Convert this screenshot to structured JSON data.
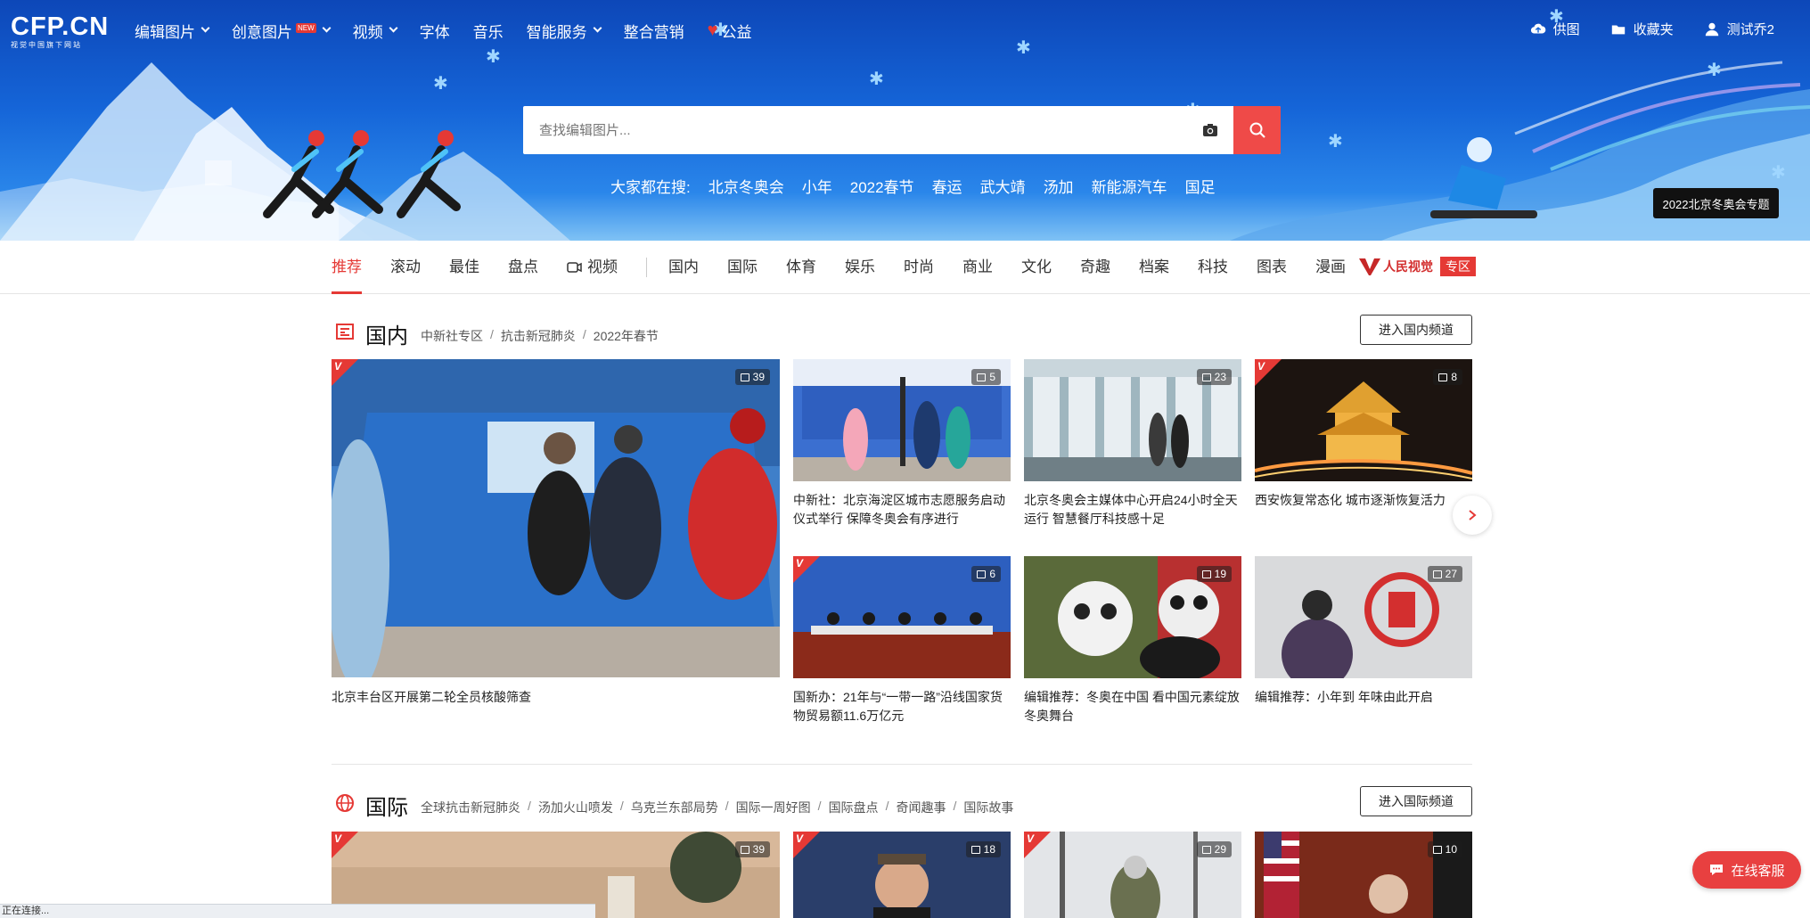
{
  "header": {
    "logo_main": "CFP.CN",
    "logo_sub": "视觉中国旗下网站",
    "nav": [
      {
        "label": "编辑图片",
        "caret": true,
        "new": false
      },
      {
        "label": "创意图片",
        "caret": true,
        "new": true
      },
      {
        "label": "视频",
        "caret": true,
        "new": false
      },
      {
        "label": "字体",
        "caret": false,
        "new": false
      },
      {
        "label": "音乐",
        "caret": false,
        "new": false
      },
      {
        "label": "智能服务",
        "caret": true,
        "new": false
      },
      {
        "label": "整合营销",
        "caret": false,
        "new": false
      },
      {
        "label": "公益",
        "caret": false,
        "new": false,
        "heart": true
      }
    ],
    "new_badge": "NEW",
    "user": {
      "upload": "供图",
      "favorites": "收藏夹",
      "username": "测试乔2"
    }
  },
  "search": {
    "placeholder": "查找编辑图片...",
    "hot_label": "大家都在搜:",
    "hot_terms": [
      "北京冬奥会",
      "小年",
      "2022春节",
      "春运",
      "武大靖",
      "汤加",
      "新能源汽车",
      "国足"
    ],
    "special_button": "2022北京冬奥会专题"
  },
  "channels": {
    "items": [
      "推荐",
      "滚动",
      "最佳",
      "盘点",
      "视频",
      "国内",
      "国际",
      "体育",
      "娱乐",
      "时尚",
      "商业",
      "文化",
      "奇趣",
      "档案",
      "科技",
      "图表",
      "漫画"
    ],
    "active": "推荐",
    "people_visual_name": "人民视觉",
    "people_visual_badge": "专区"
  },
  "section_domestic": {
    "title": "国内",
    "subtopics": [
      "中新社专区",
      "抗击新冠肺炎",
      "2022年春节"
    ],
    "enter_label": "进入国内频道",
    "cards": [
      {
        "count": "39",
        "caption": "北京丰台区开展第二轮全员核酸筛查",
        "vtag": true
      },
      {
        "count": "5",
        "caption": "中新社：北京海淀区城市志愿服务启动仪式举行 保障冬奥会有序进行",
        "vtag": false
      },
      {
        "count": "23",
        "caption": "北京冬奥会主媒体中心开启24小时全天运行 智慧餐厅科技感十足",
        "vtag": false
      },
      {
        "count": "8",
        "caption": "西安恢复常态化 城市逐渐恢复活力",
        "vtag": true
      },
      {
        "count": "6",
        "caption": "国新办：21年与“一带一路”沿线国家货物贸易额11.6万亿元",
        "vtag": true
      },
      {
        "count": "19",
        "caption": "编辑推荐：冬奥在中国 看中国元素绽放冬奥舞台",
        "vtag": false
      },
      {
        "count": "27",
        "caption": "编辑推荐：小年到 年味由此开启",
        "vtag": false
      }
    ]
  },
  "section_international": {
    "title": "国际",
    "subtopics": [
      "全球抗击新冠肺炎",
      "汤加火山喷发",
      "乌克兰东部局势",
      "国际一周好图",
      "国际盘点",
      "奇闻趣事",
      "国际故事"
    ],
    "enter_label": "进入国际频道",
    "cards": [
      {
        "count": "39",
        "vtag": true
      },
      {
        "count": "18",
        "vtag": true
      },
      {
        "count": "29",
        "vtag": true
      },
      {
        "count": "10",
        "vtag": false
      }
    ]
  },
  "service_button": "在线客服",
  "status_text": "正在连接..."
}
